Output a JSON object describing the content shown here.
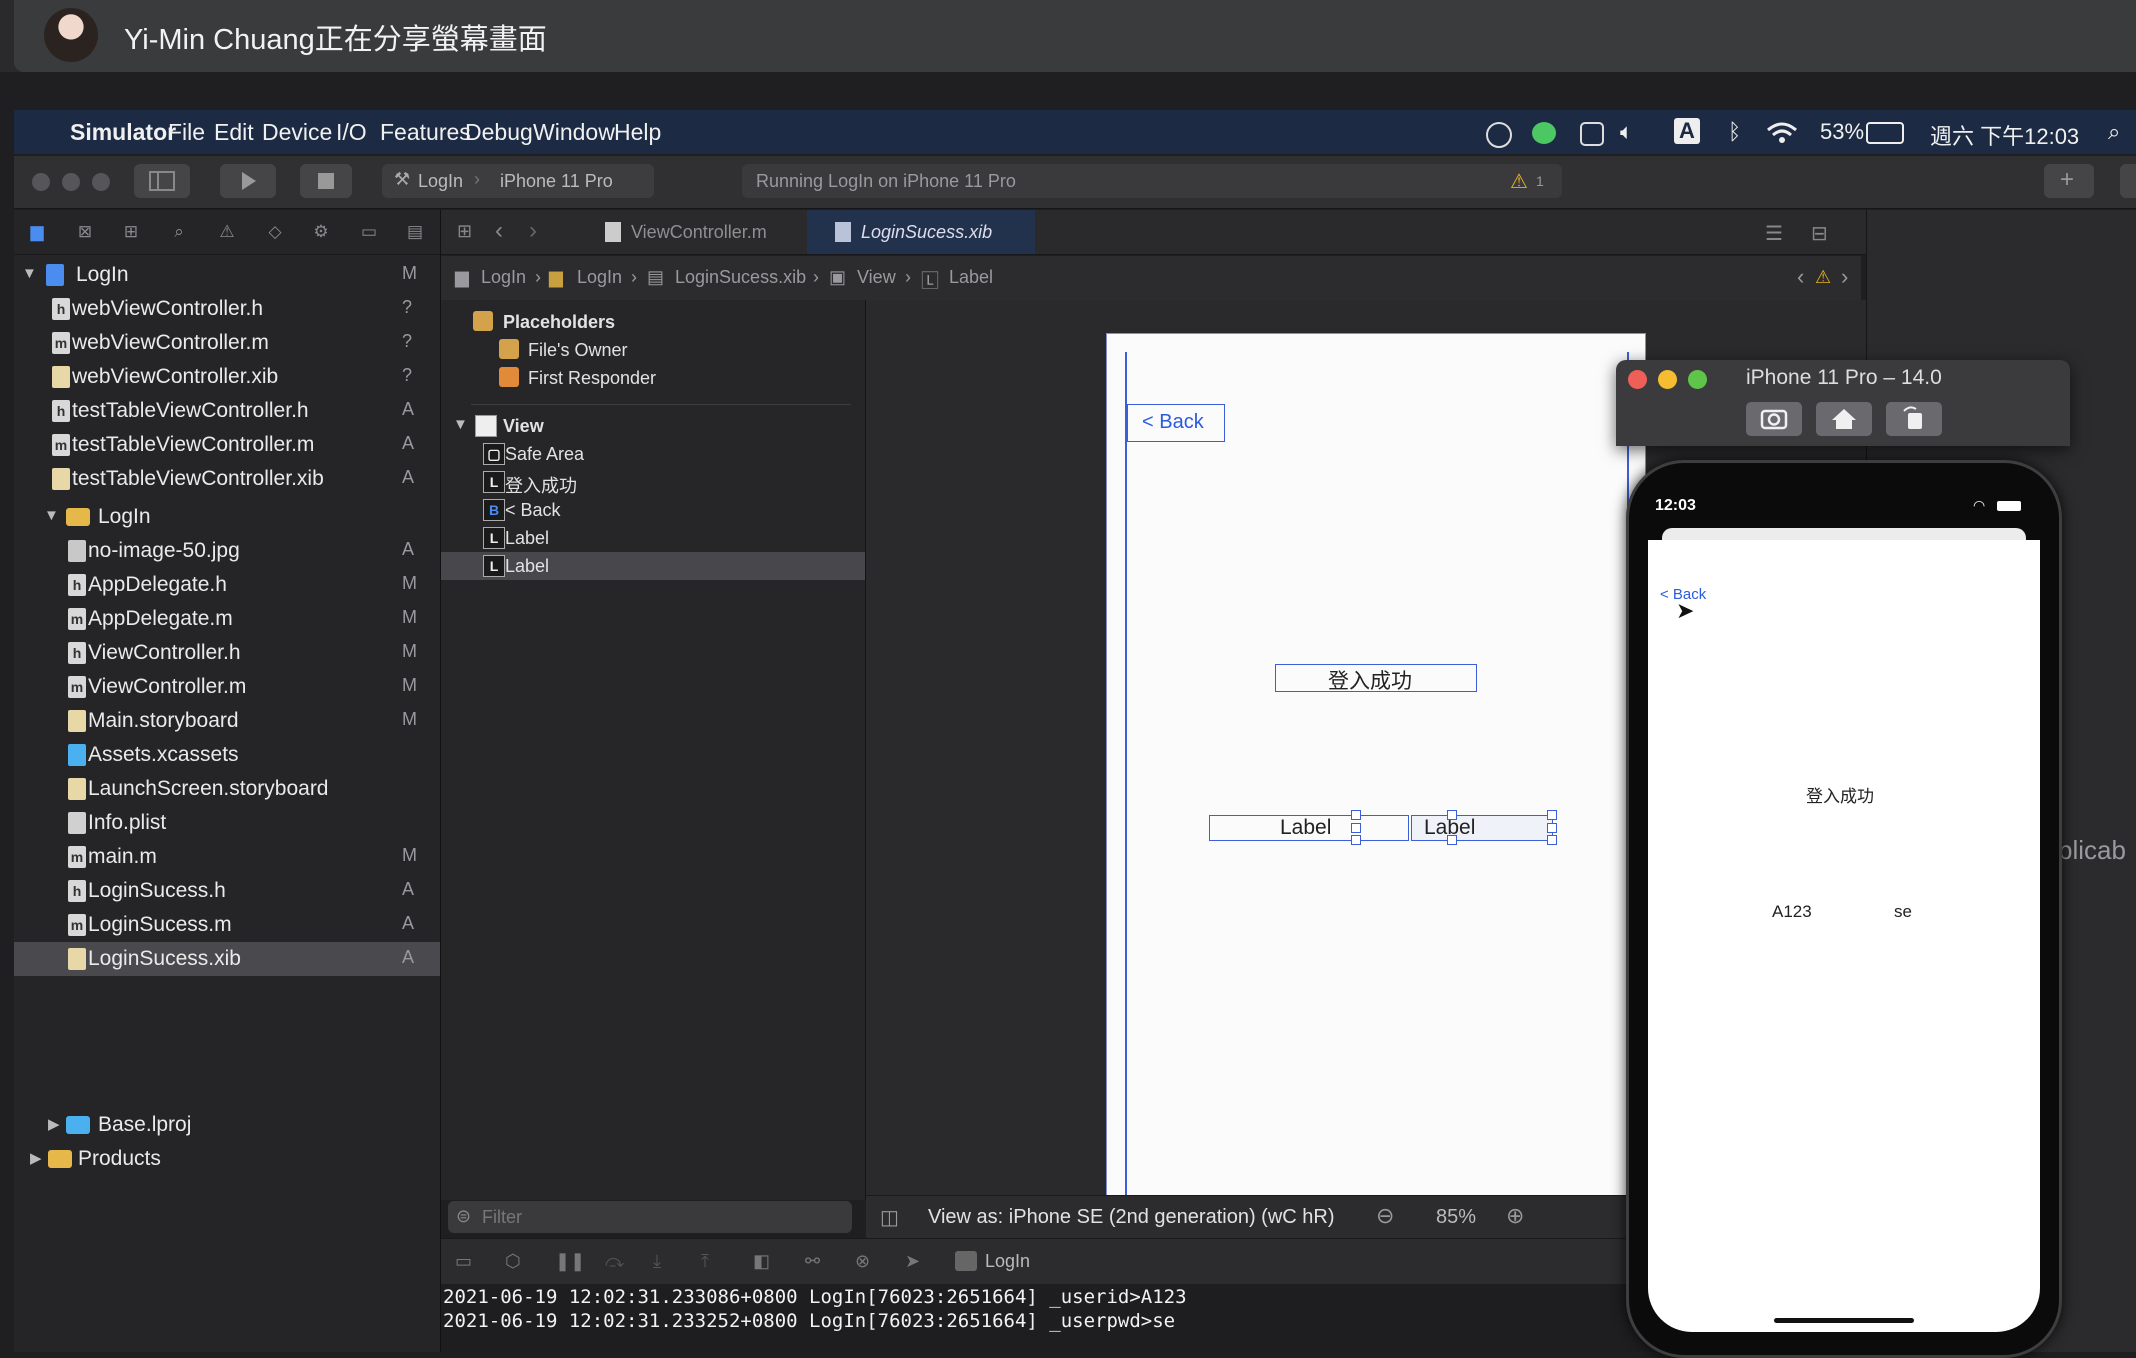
{
  "share_banner": {
    "text": "Yi-Min Chuang正在分享螢幕畫面"
  },
  "menubar": {
    "app": "Simulator",
    "items": [
      "File",
      "Edit",
      "Device",
      "I/O",
      "Features",
      "Debug",
      "Window",
      "Help"
    ],
    "battery": "53%",
    "clock": "週六 下午12:03",
    "input_mode": "A"
  },
  "toolbar": {
    "scheme": "LogIn",
    "device": "iPhone 11 Pro",
    "activity": "Running LogIn on iPhone 11 Pro",
    "warning_count": "1"
  },
  "navigator": {
    "root": {
      "label": "LogIn",
      "badge": "M"
    },
    "files": [
      {
        "label": "webViewController.h",
        "badge": "?",
        "kind": "h"
      },
      {
        "label": "webViewController.m",
        "badge": "?",
        "kind": "m"
      },
      {
        "label": "webViewController.xib",
        "badge": "?",
        "kind": "xib"
      },
      {
        "label": "testTableViewController.h",
        "badge": "A",
        "kind": "h"
      },
      {
        "label": "testTableViewController.m",
        "badge": "A",
        "kind": "m"
      },
      {
        "label": "testTableViewController.xib",
        "badge": "A",
        "kind": "xib"
      }
    ],
    "group": {
      "label": "LogIn"
    },
    "group_files": [
      {
        "label": "no-image-50.jpg",
        "badge": "A",
        "kind": "img"
      },
      {
        "label": "AppDelegate.h",
        "badge": "M",
        "kind": "h"
      },
      {
        "label": "AppDelegate.m",
        "badge": "M",
        "kind": "m"
      },
      {
        "label": "ViewController.h",
        "badge": "M",
        "kind": "h"
      },
      {
        "label": "ViewController.m",
        "badge": "M",
        "kind": "m"
      },
      {
        "label": "Main.storyboard",
        "badge": "M",
        "kind": "xib"
      },
      {
        "label": "Assets.xcassets",
        "badge": "",
        "kind": "assets"
      },
      {
        "label": "LaunchScreen.storyboard",
        "badge": "",
        "kind": "xib"
      },
      {
        "label": "Info.plist",
        "badge": "",
        "kind": "plist"
      },
      {
        "label": "main.m",
        "badge": "M",
        "kind": "m"
      },
      {
        "label": "LoginSucess.h",
        "badge": "A",
        "kind": "h"
      },
      {
        "label": "LoginSucess.m",
        "badge": "A",
        "kind": "m"
      },
      {
        "label": "LoginSucess.xib",
        "badge": "A",
        "kind": "xib"
      }
    ],
    "base": {
      "label": "Base.lproj"
    },
    "products": {
      "label": "Products"
    },
    "filter_placeholder": "Filter"
  },
  "editor": {
    "tabs": [
      {
        "label": "ViewController.m"
      },
      {
        "label": "LoginSucess.xib"
      }
    ],
    "breadcrumb": [
      "LogIn",
      "LogIn",
      "LoginSucess.xib",
      "View",
      "Label"
    ]
  },
  "outline": {
    "placeholders": "Placeholders",
    "files_owner": "File's Owner",
    "first_responder": "First Responder",
    "view": "View",
    "children": [
      {
        "ico": "▢",
        "label": "Safe Area"
      },
      {
        "ico": "L",
        "label": "登入成功"
      },
      {
        "ico": "B",
        "label": "< Back"
      },
      {
        "ico": "L",
        "label": "Label"
      },
      {
        "ico": "L",
        "label": "Label"
      }
    ],
    "filter_placeholder": "Filter"
  },
  "ib": {
    "back": "< Back",
    "title_label": "登入成功",
    "label1": "Label",
    "label2": "Label",
    "view_as": "View as: iPhone SE (2nd generation) (wC hR)",
    "zoom": "85%"
  },
  "debug": {
    "target": "LogIn"
  },
  "console": {
    "lines": [
      "2021-06-19 12:02:31.233086+0800 LogIn[76023:2651664] _userid>A123",
      "2021-06-19 12:02:31.233252+0800 LogIn[76023:2651664] _userpwd>se"
    ]
  },
  "simulator": {
    "title": "iPhone 11 Pro – 14.0",
    "status_time": "12:03",
    "back": "< Back",
    "success": "登入成功",
    "userid": "A123",
    "userpwd": "se"
  },
  "inspector": {
    "partial_text": "plicab"
  },
  "colors": {
    "accent": "#3b62d6",
    "menubar": "#1c2a44",
    "sel": "#4a4a4e"
  }
}
